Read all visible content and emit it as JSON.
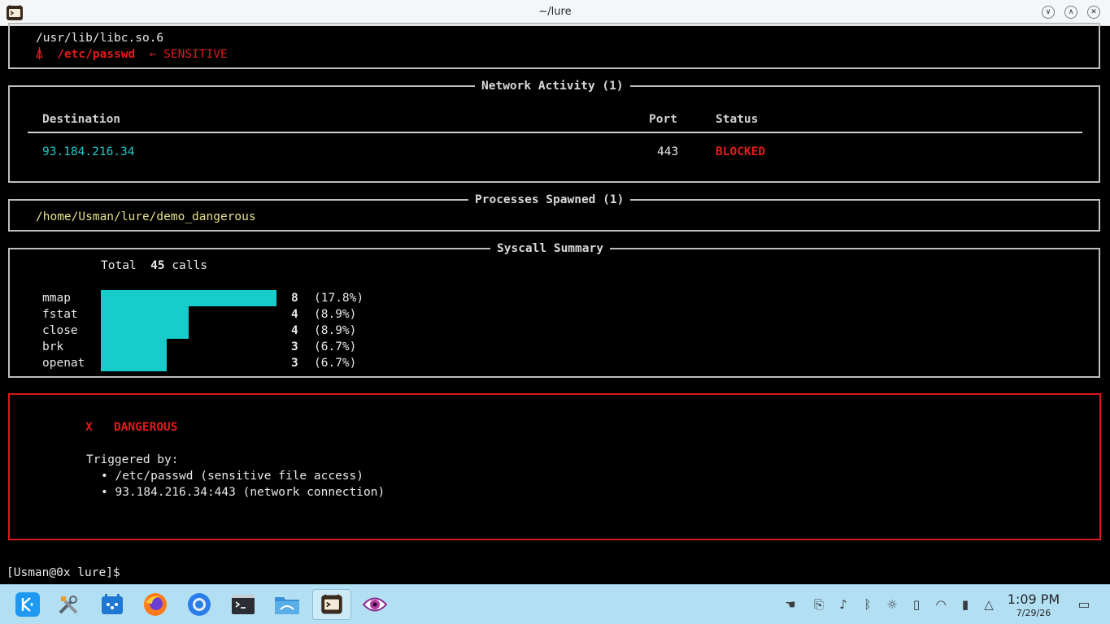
{
  "window": {
    "title": "~/lure"
  },
  "file_access": {
    "lines": [
      "/usr/lib/libc.so.6"
    ],
    "sensitive": {
      "marker": "⍋",
      "path": "/etc/passwd",
      "note": "← SENSITIVE"
    }
  },
  "network": {
    "title": "Network Activity (1)",
    "columns": [
      "Destination",
      "Port",
      "Status"
    ],
    "rows": [
      {
        "destination": "93.184.216.34",
        "port": "443",
        "status": "BLOCKED"
      }
    ]
  },
  "processes": {
    "title": "Processes Spawned (1)",
    "items": [
      "/home/Usman/lure/demo_dangerous"
    ]
  },
  "syscalls": {
    "title": "Syscall Summary",
    "total_label": "Total",
    "total": "45",
    "total_suffix": "calls",
    "rows": [
      {
        "name": "mmap",
        "count": "8",
        "pct": "(17.8%)",
        "fraction": 1.0
      },
      {
        "name": "fstat",
        "count": "4",
        "pct": "(8.9%)",
        "fraction": 0.5
      },
      {
        "name": "close",
        "count": "4",
        "pct": "(8.9%)",
        "fraction": 0.5
      },
      {
        "name": "brk",
        "count": "3",
        "pct": "(6.7%)",
        "fraction": 0.375
      },
      {
        "name": "openat",
        "count": "3",
        "pct": "(6.7%)",
        "fraction": 0.375
      }
    ]
  },
  "verdict": {
    "icon": "X",
    "label": "DANGEROUS",
    "triggered_by": "Triggered by:",
    "reasons": [
      "• /etc/passwd (sensitive file access)",
      "• 93.184.216.34:443 (network connection)"
    ]
  },
  "prompt": "[Usman@0x lure]$",
  "taskbar": {
    "apps": [
      "kde-menu-icon",
      "system-settings-icon",
      "discover-icon",
      "firefox-icon",
      "chrome-icon",
      "konsole-icon",
      "dolphin-icon",
      "lure-icon",
      "eye-icon"
    ],
    "clock": {
      "time": "1:09 PM",
      "date": "7/29/26"
    }
  },
  "colors": {
    "cyan": "#1fc8c8",
    "red": "#e01b1b",
    "yellow": "#e6e08a",
    "taskbar": "#b3dff3"
  }
}
